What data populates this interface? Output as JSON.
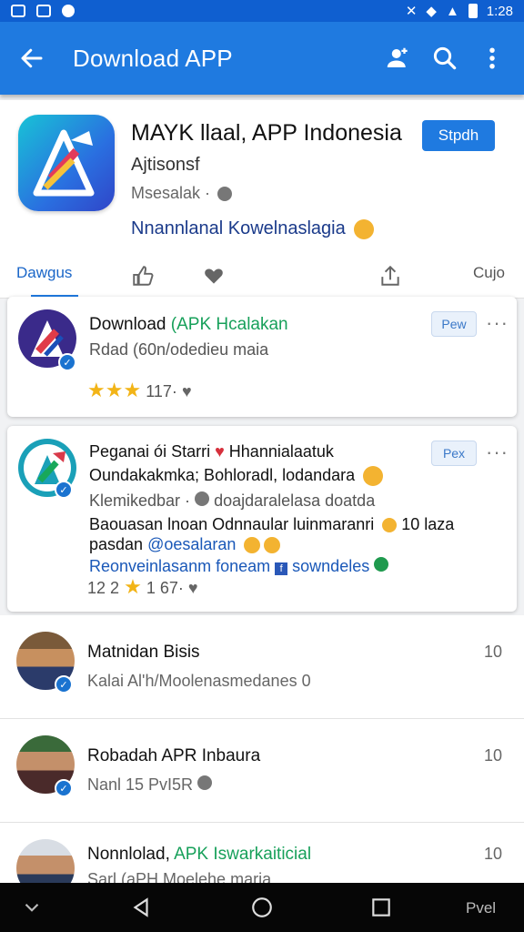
{
  "status_bar": {
    "time": "1:28",
    "battery_icon": "battery-icon"
  },
  "app_bar": {
    "title": "Download APP"
  },
  "app_header": {
    "name": "MAYK llaal, APP Indonesia",
    "install_label": "Stpdh",
    "subtitle": "Ajtisonsf",
    "meta": "Msesalak ·",
    "tagline": "Nnannlanal Kowelnaslagia"
  },
  "tabs": {
    "first": "Dawgus",
    "last": "Cujo"
  },
  "posts": [
    {
      "title_prefix": "Download",
      "title_green": "(APK Hcalakan",
      "subtitle": "Rdad (60n/odedieu maia",
      "pill": "Pew",
      "rating": "117·"
    },
    {
      "line1": "Peganai ói Starri",
      "line1_b": "Hhannialaatuk",
      "line2": "Oundakakmka; Bohloradl, lodandara",
      "line3": "Klemikedbar · ",
      "line3_b": "doajdaralelasa doatda",
      "line4": "Baouasan lnoan Odnnaular luinmaranri",
      "line4_b": "10 laza",
      "line5": "pasdan",
      "line5_link": "@oesalaran",
      "line6": "Reonveinlasanm foneam",
      "line6_b": "sowndeles",
      "rating_prefix": "12 2",
      "rating": "1 67·",
      "pill": "Pex"
    }
  ],
  "list": [
    {
      "title": "Matnidan Bisis",
      "sub": "Kalai Al'h/Moolenasmedanes 0",
      "count": "10"
    },
    {
      "title": "Robadah APR Inbaura",
      "sub": "Nanl 15 PvI5R",
      "count": "10"
    },
    {
      "title_prefix": "Nonnlolad,",
      "title_green": "APK Iswarkaiticial",
      "sub": "Sarl (aPH Moelehe maria",
      "count": "10"
    }
  ],
  "nav": {
    "right_label": "Pvel"
  }
}
